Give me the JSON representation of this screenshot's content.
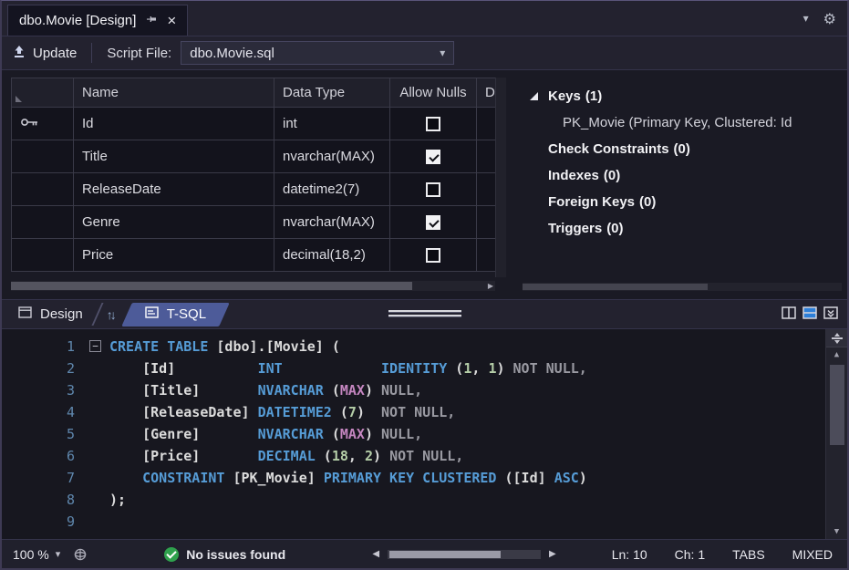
{
  "window": {
    "tab_title": "dbo.Movie [Design]"
  },
  "toolbar": {
    "update_label": "Update",
    "script_file_label": "Script File:",
    "script_file_value": "dbo.Movie.sql"
  },
  "designer": {
    "columns": {
      "name": "Name",
      "data_type": "Data Type",
      "allow_nulls": "Allow Nulls",
      "default": "D"
    },
    "rows": [
      {
        "name": "Id",
        "data_type": "int",
        "allow_nulls": false,
        "is_key": true
      },
      {
        "name": "Title",
        "data_type": "nvarchar(MAX)",
        "allow_nulls": true,
        "is_key": false
      },
      {
        "name": "ReleaseDate",
        "data_type": "datetime2(7)",
        "allow_nulls": false,
        "is_key": false
      },
      {
        "name": "Genre",
        "data_type": "nvarchar(MAX)",
        "allow_nulls": true,
        "is_key": false
      },
      {
        "name": "Price",
        "data_type": "decimal(18,2)",
        "allow_nulls": false,
        "is_key": false
      }
    ]
  },
  "keys_panel": {
    "items": [
      {
        "label": "Keys",
        "count": "(1)",
        "expanded": true,
        "children": [
          "PK_Movie  (Primary Key, Clustered: Id"
        ]
      },
      {
        "label": "Check Constraints",
        "count": "(0)"
      },
      {
        "label": "Indexes",
        "count": "(0)"
      },
      {
        "label": "Foreign Keys",
        "count": "(0)"
      },
      {
        "label": "Triggers",
        "count": "(0)"
      }
    ]
  },
  "pane_tabs": {
    "design_label": "Design",
    "tsql_label": "T-SQL"
  },
  "editor": {
    "lines": [
      {
        "n": "1",
        "fold": true,
        "tokens": [
          [
            "k",
            "CREATE TABLE"
          ],
          [
            "p",
            " [dbo].[Movie] ("
          ]
        ]
      },
      {
        "n": "2",
        "fold": false,
        "tokens": [
          [
            "p",
            "    [Id]          "
          ],
          [
            "k",
            "INT"
          ],
          [
            "p",
            "            "
          ],
          [
            "k",
            "IDENTITY"
          ],
          [
            "p",
            " ("
          ],
          [
            "n",
            "1"
          ],
          [
            "p",
            ", "
          ],
          [
            "n",
            "1"
          ],
          [
            "p",
            ") "
          ],
          [
            "g",
            "NOT NULL,"
          ]
        ]
      },
      {
        "n": "3",
        "fold": false,
        "tokens": [
          [
            "p",
            "    [Title]       "
          ],
          [
            "k",
            "NVARCHAR"
          ],
          [
            "p",
            " ("
          ],
          [
            "m",
            "MAX"
          ],
          [
            "p",
            ") "
          ],
          [
            "g",
            "NULL,"
          ]
        ]
      },
      {
        "n": "4",
        "fold": false,
        "tokens": [
          [
            "p",
            "    [ReleaseDate] "
          ],
          [
            "k",
            "DATETIME2"
          ],
          [
            "p",
            " ("
          ],
          [
            "n",
            "7"
          ],
          [
            "p",
            ")  "
          ],
          [
            "g",
            "NOT NULL,"
          ]
        ]
      },
      {
        "n": "5",
        "fold": false,
        "tokens": [
          [
            "p",
            "    [Genre]       "
          ],
          [
            "k",
            "NVARCHAR"
          ],
          [
            "p",
            " ("
          ],
          [
            "m",
            "MAX"
          ],
          [
            "p",
            ") "
          ],
          [
            "g",
            "NULL,"
          ]
        ]
      },
      {
        "n": "6",
        "fold": false,
        "tokens": [
          [
            "p",
            "    [Price]       "
          ],
          [
            "k",
            "DECIMAL"
          ],
          [
            "p",
            " ("
          ],
          [
            "n",
            "18"
          ],
          [
            "p",
            ", "
          ],
          [
            "n",
            "2"
          ],
          [
            "p",
            ") "
          ],
          [
            "g",
            "NOT NULL,"
          ]
        ]
      },
      {
        "n": "7",
        "fold": false,
        "tokens": [
          [
            "p",
            "    "
          ],
          [
            "k",
            "CONSTRAINT"
          ],
          [
            "p",
            " [PK_Movie] "
          ],
          [
            "k",
            "PRIMARY KEY CLUSTERED"
          ],
          [
            "p",
            " ([Id] "
          ],
          [
            "k",
            "ASC"
          ],
          [
            "p",
            ")"
          ]
        ]
      },
      {
        "n": "8",
        "fold": false,
        "tokens": [
          [
            "p",
            ");"
          ]
        ]
      },
      {
        "n": "9",
        "fold": false,
        "tokens": []
      }
    ]
  },
  "status_bar": {
    "zoom": "100 %",
    "message": "No issues found",
    "line": "Ln: 10",
    "column": "Ch: 1",
    "tabs_label": "TABS",
    "encoding_label": "MIXED"
  },
  "colors": {
    "tsql_tab_accent": "#4d5b99",
    "keyword_blue": "#569cd6",
    "max_magenta": "#c586c0",
    "success_green": "#2fa14d"
  }
}
